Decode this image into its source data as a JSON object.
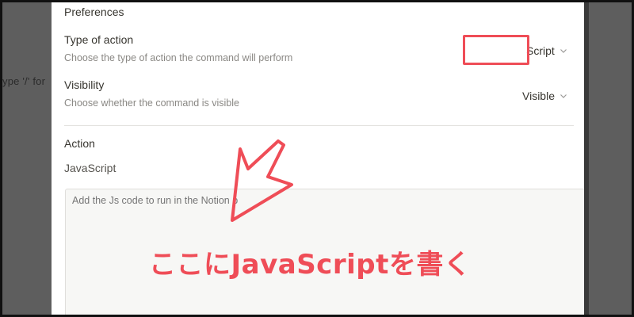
{
  "background": {
    "hint_text": "ype '/' for"
  },
  "preferences": {
    "title": "Preferences",
    "type_of_action": {
      "label": "Type of action",
      "description": "Choose the type of action the command will perform",
      "value": "Script"
    },
    "visibility": {
      "label": "Visibility",
      "description": "Choose whether the command is visible",
      "value": "Visible"
    }
  },
  "action": {
    "title": "Action",
    "language": "JavaScript",
    "code_placeholder": "Add the Js code to run in the Notion p"
  },
  "annotation": {
    "text": "ここにJavaScriptを書く",
    "color": "#ef4d57"
  },
  "icons": [
    "chevron-down-icon",
    "annotation-arrow-icon"
  ]
}
